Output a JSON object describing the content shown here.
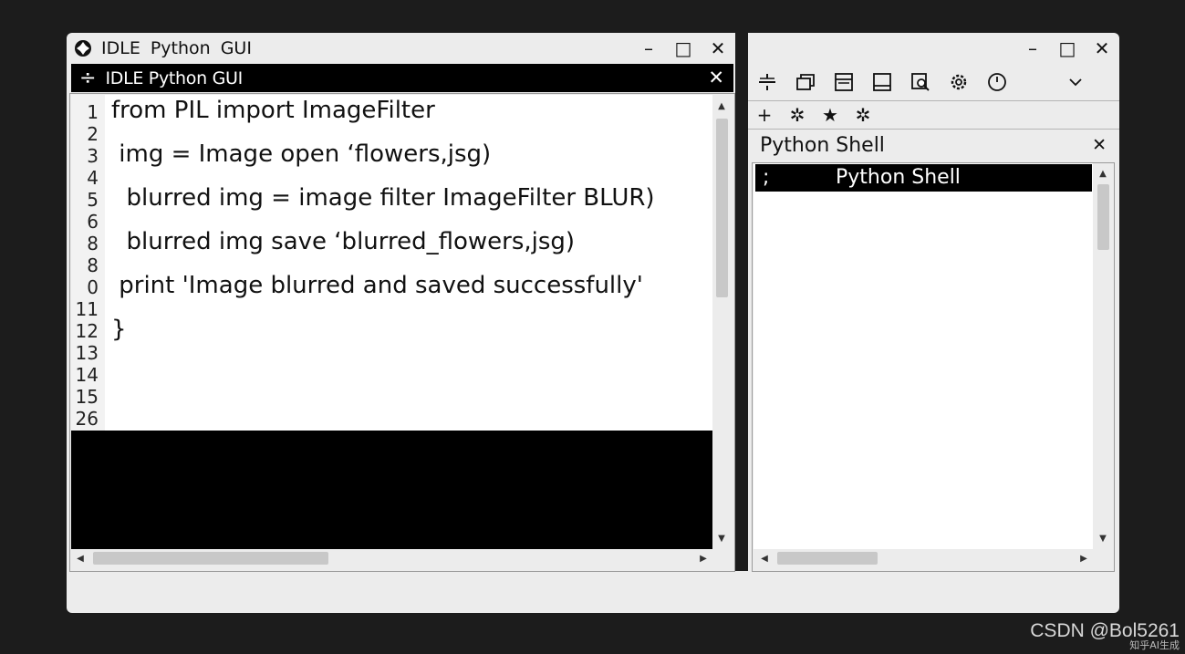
{
  "left_window": {
    "menu": [
      "IDLE",
      "Python",
      "GUI"
    ],
    "controls": [
      "–",
      "□",
      "✕"
    ],
    "doc_tab": {
      "icon": "÷",
      "title": "IDLE Python GUI",
      "close": "✕"
    },
    "line_numbers": [
      "1",
      "2",
      "3",
      "4",
      "5",
      "6",
      "8",
      "8",
      "0",
      "11",
      "12",
      "13",
      "14",
      "15",
      "26"
    ],
    "code_lines": [
      "from PIL import ImageFilter",
      " img = Image open ‘flowers,jsg)",
      "  blurred img = image filter ImageFilter BLUR)",
      "  blurred img save ‘blurred_flowers,jsg)",
      " print 'Image blurred and saved successfully'",
      "}"
    ]
  },
  "right_window": {
    "controls": [
      "–",
      "□",
      "✕"
    ],
    "toolbar_icons": [
      "divide-icon",
      "windows-icon",
      "panel-icon",
      "window-bottom-icon",
      "search-window-icon",
      "gear-icon",
      "clock-icon",
      "chevron-down-icon"
    ],
    "toolbar2_icons": [
      {
        "name": "plus-icon",
        "glyph": "+"
      },
      {
        "name": "sun-icon",
        "glyph": "✲"
      },
      {
        "name": "star-icon",
        "glyph": "★"
      },
      {
        "name": "settings-icon",
        "glyph": "✲"
      }
    ],
    "shell_title": "Python Shell",
    "shell_close": "✕",
    "shell_prompt": ";",
    "shell_row_text": "Python Shell"
  },
  "watermark": {
    "text": "CSDN @Bol5261",
    "sub": "知乎AI生成"
  }
}
